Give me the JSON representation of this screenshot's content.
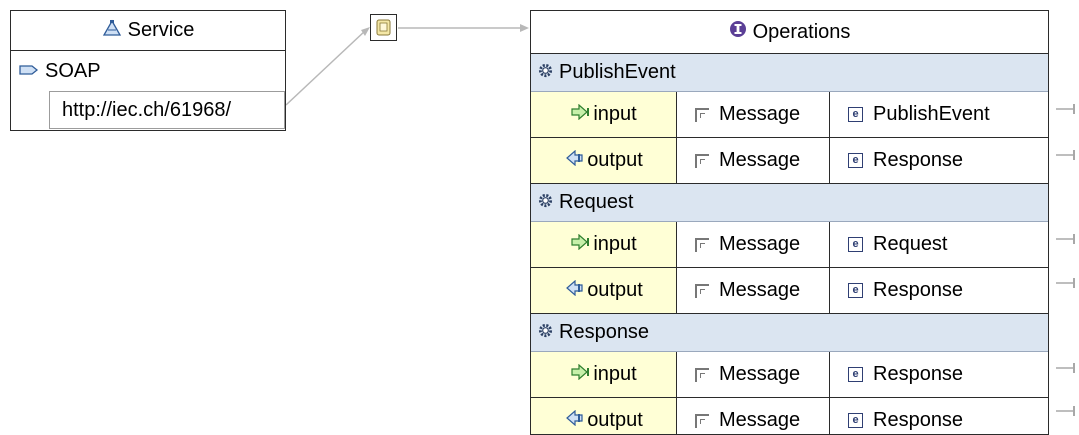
{
  "service": {
    "title": "Service",
    "binding": "SOAP",
    "address": "http://iec.ch/61968/"
  },
  "operations_panel": {
    "title": "Operations",
    "operations": [
      {
        "name": "PublishEvent",
        "messages": [
          {
            "direction": "input",
            "type": "Message",
            "element": "PublishEvent"
          },
          {
            "direction": "output",
            "type": "Message",
            "element": "Response"
          }
        ]
      },
      {
        "name": "Request",
        "messages": [
          {
            "direction": "input",
            "type": "Message",
            "element": "Request"
          },
          {
            "direction": "output",
            "type": "Message",
            "element": "Response"
          }
        ]
      },
      {
        "name": "Response",
        "messages": [
          {
            "direction": "input",
            "type": "Message",
            "element": "Response"
          },
          {
            "direction": "output",
            "type": "Message",
            "element": "Response"
          }
        ]
      }
    ]
  },
  "colors": {
    "operation_row_bg": "#dbe5f1",
    "direction_cell_bg": "#ffffd6",
    "border": "#2b2b2b",
    "connector": "#b0b0b0"
  }
}
